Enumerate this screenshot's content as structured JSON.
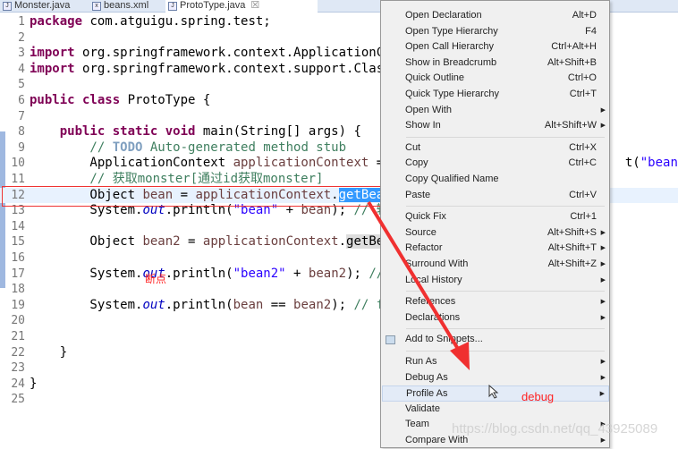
{
  "tabs": [
    {
      "label": "Monster.java",
      "icon": "java-file-icon"
    },
    {
      "label": "beans.xml",
      "icon": "xml-file-icon"
    },
    {
      "label": "ProtoType.java",
      "icon": "java-file-icon",
      "active": true,
      "close": "☒"
    }
  ],
  "code": [
    [
      [
        "package ",
        "kw"
      ],
      [
        "com.atguigu.spring.test;",
        ""
      ]
    ],
    [],
    [
      [
        "import ",
        "kw"
      ],
      [
        "org.springframework.context.ApplicationCon",
        ""
      ]
    ],
    [
      [
        "import ",
        "kw"
      ],
      [
        "org.springframework.context.support.ClassP",
        ""
      ]
    ],
    [],
    [
      [
        "public class ",
        "kw"
      ],
      [
        "ProtoType {",
        ""
      ]
    ],
    [],
    [
      [
        "    public static void ",
        "kw"
      ],
      [
        "main(String[] ",
        ""
      ],
      [
        "args",
        ""
      ],
      [
        ") {",
        ""
      ]
    ],
    [
      [
        "        // ",
        "cm"
      ],
      [
        "TODO",
        "todo"
      ],
      [
        " Auto-generated method stub",
        "cm"
      ]
    ],
    [
      [
        "        ApplicationContext ",
        ""
      ],
      [
        "applicationContext",
        "var"
      ],
      [
        " = n",
        ""
      ],
      [
        "                              t(",
        ""
      ],
      [
        "\"beans.x",
        "st"
      ]
    ],
    [
      [
        "        // 获取monster[通过id获取monster]",
        "cm"
      ]
    ],
    [
      [
        "        Object ",
        ""
      ],
      [
        "bean",
        "var"
      ],
      [
        " = ",
        ""
      ],
      [
        "applicationContext",
        "var"
      ],
      [
        ".",
        ""
      ],
      [
        "getBean",
        "sel"
      ],
      [
        "(",
        ""
      ]
    ],
    [
      [
        "        System.",
        ""
      ],
      [
        "out",
        "fd"
      ],
      [
        ".println(",
        ""
      ],
      [
        "\"bean\"",
        "st"
      ],
      [
        " + ",
        ""
      ],
      [
        "bean",
        "var"
      ],
      [
        "); ",
        ""
      ],
      [
        "// 输出",
        "cm"
      ]
    ],
    [],
    [
      [
        "        Object ",
        ""
      ],
      [
        "bean2",
        "var"
      ],
      [
        " = ",
        ""
      ],
      [
        "applicationContext",
        "var"
      ],
      [
        ".",
        ""
      ],
      [
        "getBean",
        "gb"
      ]
    ],
    [],
    [
      [
        "        System.",
        ""
      ],
      [
        "out",
        "fd"
      ],
      [
        ".println(",
        ""
      ],
      [
        "\"bean2\"",
        "st"
      ],
      [
        " + ",
        ""
      ],
      [
        "bean2",
        "var"
      ],
      [
        "); ",
        ""
      ],
      [
        "//输",
        "cm"
      ]
    ],
    [],
    [
      [
        "        System.",
        ""
      ],
      [
        "out",
        "fd"
      ],
      [
        ".println(",
        ""
      ],
      [
        "bean",
        "var"
      ],
      [
        " == ",
        ""
      ],
      [
        "bean2",
        "var"
      ],
      [
        "); ",
        ""
      ],
      [
        "// fal",
        "cm"
      ]
    ],
    [],
    [],
    [
      [
        "    }",
        ""
      ]
    ],
    [],
    [
      [
        "}",
        ""
      ]
    ],
    []
  ],
  "menu": [
    {
      "label": "Open Declaration",
      "shortcut": "Alt+D"
    },
    {
      "label": "Open Type Hierarchy",
      "shortcut": "F4"
    },
    {
      "label": "Open Call Hierarchy",
      "shortcut": "Ctrl+Alt+H"
    },
    {
      "label": "Show in Breadcrumb",
      "shortcut": "Alt+Shift+B"
    },
    {
      "label": "Quick Outline",
      "shortcut": "Ctrl+O"
    },
    {
      "label": "Quick Type Hierarchy",
      "shortcut": "Ctrl+T"
    },
    {
      "label": "Open With",
      "shortcut": "",
      "submenu": true
    },
    {
      "label": "Show In",
      "shortcut": "Alt+Shift+W",
      "submenu": true
    },
    {
      "sep": true
    },
    {
      "label": "Cut",
      "shortcut": "Ctrl+X"
    },
    {
      "label": "Copy",
      "shortcut": "Ctrl+C"
    },
    {
      "label": "Copy Qualified Name",
      "shortcut": ""
    },
    {
      "label": "Paste",
      "shortcut": "Ctrl+V"
    },
    {
      "sep": true
    },
    {
      "label": "Quick Fix",
      "shortcut": "Ctrl+1"
    },
    {
      "label": "Source",
      "shortcut": "Alt+Shift+S",
      "submenu": true
    },
    {
      "label": "Refactor",
      "shortcut": "Alt+Shift+T",
      "submenu": true
    },
    {
      "label": "Surround With",
      "shortcut": "Alt+Shift+Z",
      "submenu": true
    },
    {
      "label": "Local History",
      "shortcut": "",
      "submenu": true
    },
    {
      "sep": true
    },
    {
      "label": "References",
      "shortcut": "",
      "submenu": true
    },
    {
      "label": "Declarations",
      "shortcut": "",
      "submenu": true
    },
    {
      "sep": true
    },
    {
      "label": "Add to Snippets...",
      "shortcut": "",
      "icon": "snippet-icon"
    },
    {
      "sep": true
    },
    {
      "label": "Run As",
      "shortcut": "",
      "submenu": true
    },
    {
      "label": "Debug As",
      "shortcut": "",
      "submenu": true
    },
    {
      "label": "Profile As",
      "shortcut": "",
      "submenu": true,
      "highlighted": true
    },
    {
      "label": "Validate",
      "shortcut": ""
    },
    {
      "label": "Team",
      "shortcut": "",
      "submenu": true
    },
    {
      "label": "Compare With",
      "shortcut": "",
      "submenu": true
    }
  ],
  "annotations": {
    "breakpoint": "断点",
    "debug": "debug",
    "arrow_color": "#f03030"
  },
  "watermark": "https://blog.csdn.net/qq_43925089"
}
